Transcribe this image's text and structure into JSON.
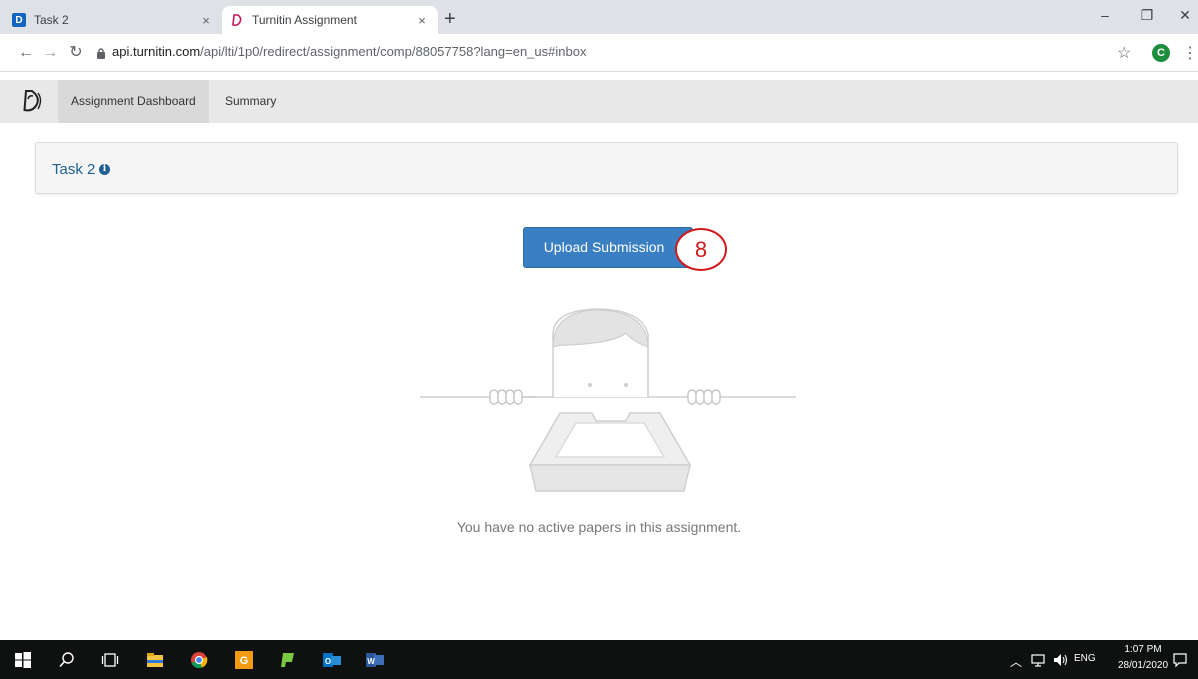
{
  "browser": {
    "tabs": [
      {
        "title": "Task 2",
        "favicon_letter": "D",
        "close": "×"
      },
      {
        "title": "Turnitin Assignment",
        "close": "×"
      }
    ],
    "new_tab": "+",
    "window_controls": {
      "minimize": "–",
      "restore": "❐",
      "close": "✕"
    },
    "url_host": "api.turnitin.com",
    "url_path": "/api/lti/1p0/redirect/assignment/comp/88057758?lang=en_us#inbox",
    "profile_initial": "C"
  },
  "nav": {
    "tabs": [
      {
        "label": "Assignment Dashboard"
      },
      {
        "label": "Summary"
      }
    ]
  },
  "assignment": {
    "title": "Task 2",
    "info_glyph": "i"
  },
  "upload_button": {
    "label": "Upload Submission"
  },
  "step_marker": "8",
  "empty_state": {
    "message": "You have no active papers in this assignment."
  },
  "taskbar": {
    "language": "ENG",
    "time": "1:07 PM",
    "date": "28/01/2020"
  },
  "colors": {
    "primary_button": "#3a7fc1",
    "task_title": "#1f5f91",
    "step_marker": "#d0191a"
  }
}
